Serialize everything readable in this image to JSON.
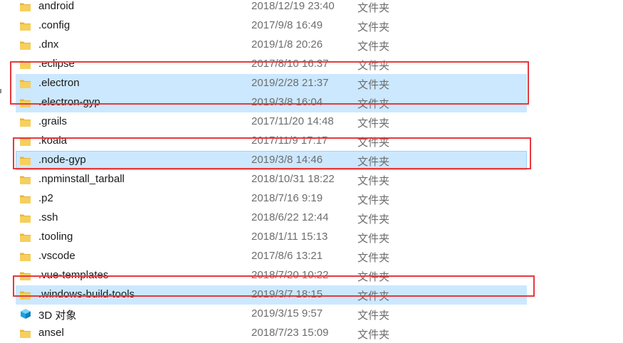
{
  "rows": [
    {
      "name": "android",
      "date": "2018/12/19 23:40",
      "type": "文件夹",
      "icon": "folder-icon",
      "selected": false
    },
    {
      "name": ".config",
      "date": "2017/9/8 16:49",
      "type": "文件夹",
      "icon": "folder-icon",
      "selected": false
    },
    {
      "name": ".dnx",
      "date": "2019/1/8 20:26",
      "type": "文件夹",
      "icon": "folder-icon",
      "selected": false
    },
    {
      "name": ".eclipse",
      "date": "2017/8/10 16:37",
      "type": "文件夹",
      "icon": "folder-icon",
      "selected": false
    },
    {
      "name": ".electron",
      "date": "2019/2/28 21:37",
      "type": "文件夹",
      "icon": "folder-icon",
      "selected": true
    },
    {
      "name": ".electron-gyp",
      "date": "2019/3/8 16:04",
      "type": "文件夹",
      "icon": "folder-icon",
      "selected": true
    },
    {
      "name": ".grails",
      "date": "2017/11/20 14:48",
      "type": "文件夹",
      "icon": "folder-icon",
      "selected": false
    },
    {
      "name": ".koala",
      "date": "2017/11/9 17:17",
      "type": "文件夹",
      "icon": "folder-icon",
      "selected": false
    },
    {
      "name": ".node-gyp",
      "date": "2019/3/8 14:46",
      "type": "文件夹",
      "icon": "folder-icon",
      "selected": true
    },
    {
      "name": ".npminstall_tarball",
      "date": "2018/10/31 18:22",
      "type": "文件夹",
      "icon": "folder-icon",
      "selected": false
    },
    {
      "name": ".p2",
      "date": "2018/7/16 9:19",
      "type": "文件夹",
      "icon": "folder-icon",
      "selected": false
    },
    {
      "name": ".ssh",
      "date": "2018/6/22 12:44",
      "type": "文件夹",
      "icon": "folder-icon",
      "selected": false
    },
    {
      "name": ".tooling",
      "date": "2018/1/11 15:13",
      "type": "文件夹",
      "icon": "folder-icon",
      "selected": false
    },
    {
      "name": ".vscode",
      "date": "2017/8/6 13:21",
      "type": "文件夹",
      "icon": "folder-icon",
      "selected": false
    },
    {
      "name": ".vue-templates",
      "date": "2018/7/20 10:22",
      "type": "文件夹",
      "icon": "folder-icon",
      "selected": false
    },
    {
      "name": ".windows-build-tools",
      "date": "2019/3/7 18:15",
      "type": "文件夹",
      "icon": "folder-icon",
      "selected": true
    },
    {
      "name": "3D 对象",
      "date": "2019/3/15 9:57",
      "type": "文件夹",
      "icon": "3d-objects-icon",
      "selected": false
    },
    {
      "name": "ansel",
      "date": "2018/7/23 15:09",
      "type": "文件夹",
      "icon": "folder-icon",
      "selected": false
    }
  ],
  "colors": {
    "selection": "#cce8ff",
    "annotation": "#e8383d",
    "folder": "#f4c352"
  }
}
